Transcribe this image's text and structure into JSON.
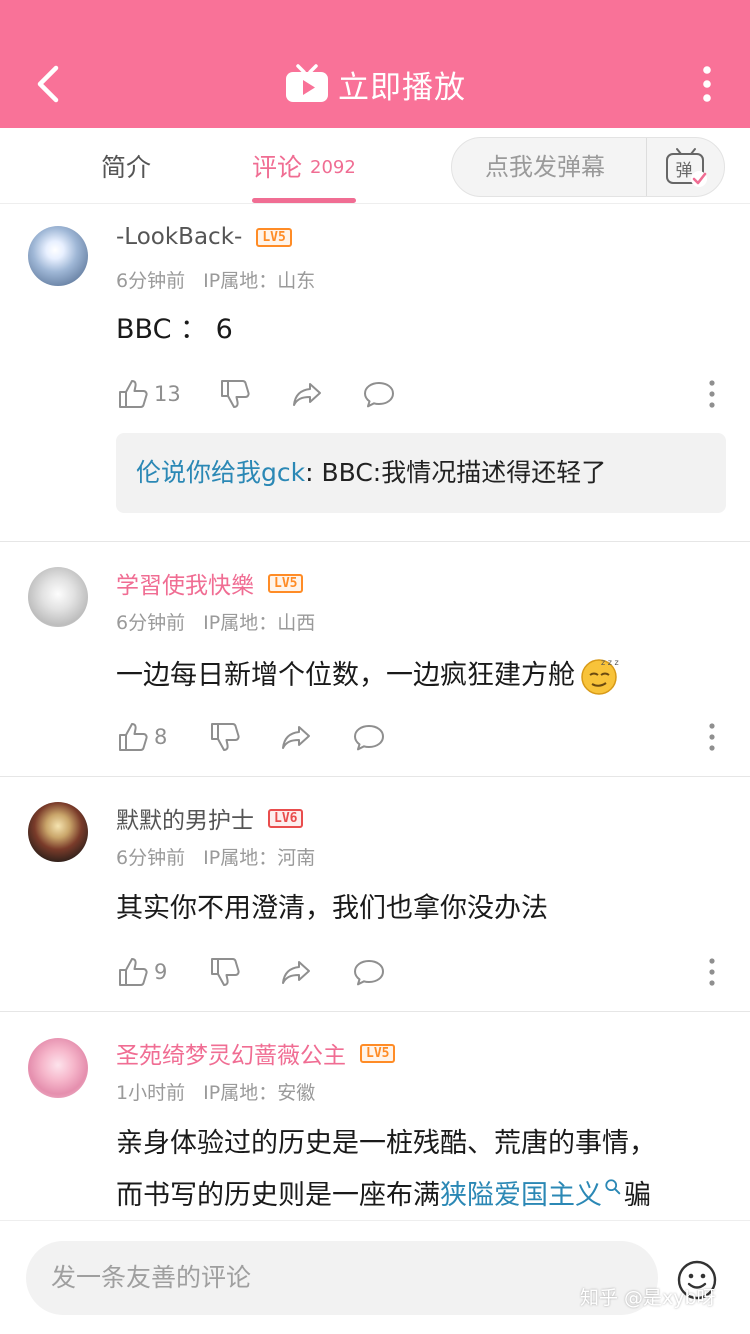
{
  "header": {
    "title": "立即播放"
  },
  "tabs": [
    {
      "label": "简介"
    },
    {
      "label": "评论",
      "count": "2092"
    }
  ],
  "danmaku": {
    "placeholder": "点我发弹幕",
    "icon_label": "弹"
  },
  "comments": [
    {
      "username": "-LookBack-",
      "username_color": "#555555",
      "level": "LV5",
      "time": "6分钟前",
      "ip": "IP属地：山东",
      "content": "BBC ： 6",
      "likes": "13",
      "reply": {
        "name": "伦说你给我gck",
        "text": ": BBC:我情况描述得还轻了"
      }
    },
    {
      "username": "学習使我快樂",
      "username_color": "#f06d93",
      "level": "LV5",
      "time": "6分钟前",
      "ip": "IP属地：山西",
      "content": "一边每日新增个位数，一边疯狂建方舱",
      "likes": "8"
    },
    {
      "username": "默默的男护士",
      "username_color": "#555555",
      "level": "LV6",
      "time": "6分钟前",
      "ip": "IP属地：河南",
      "content": "其实你不用澄清，我们也拿你没办法",
      "likes": "9"
    },
    {
      "username": "圣苑绮梦灵幻蔷薇公主",
      "username_color": "#f06d93",
      "level": "LV5",
      "time": "1小时前",
      "ip": "IP属地：安徽",
      "content_line1": "亲身体验过的历史是一桩残酷、荒唐的事情，",
      "content_line2_pre": "而书写的历史则是一座布满",
      "content_link": "狭隘爱国主义",
      "content_line2_post": "骗"
    }
  ],
  "bottom": {
    "input_placeholder": "发一条友善的评论",
    "watermark": "知乎 @是xyb呀"
  },
  "colors": {
    "brand_pink": "#f97298",
    "accent_pink": "#f06d93",
    "link_blue": "#2b88b5"
  }
}
